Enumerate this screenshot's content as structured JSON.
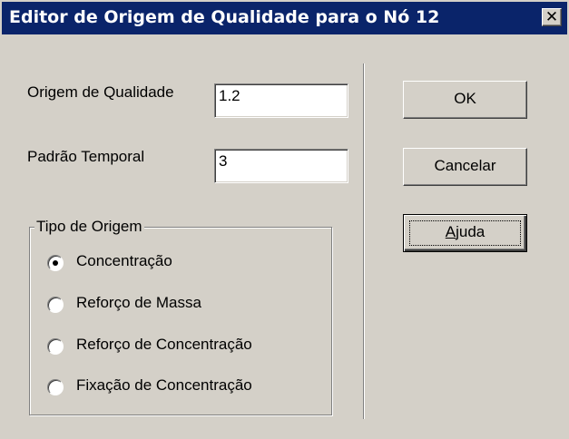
{
  "window": {
    "title": "Editor de Origem de Qualidade para o Nó 12",
    "close_glyph": "✕"
  },
  "fields": {
    "source_quality_label": "Origem de Qualidade",
    "source_quality_value": "1.2",
    "time_pattern_label": "Padrão Temporal",
    "time_pattern_value": "3"
  },
  "source_type": {
    "title": "Tipo de Origem",
    "options": [
      {
        "label": "Concentração",
        "selected": true
      },
      {
        "label": "Reforço de Massa",
        "selected": false
      },
      {
        "label": "Reforço de Concentração",
        "selected": false
      },
      {
        "label": "Fixação de Concentração",
        "selected": false
      }
    ]
  },
  "buttons": {
    "ok": "OK",
    "cancel": "Cancelar",
    "help_mnemonic": "A",
    "help_rest": "juda"
  }
}
